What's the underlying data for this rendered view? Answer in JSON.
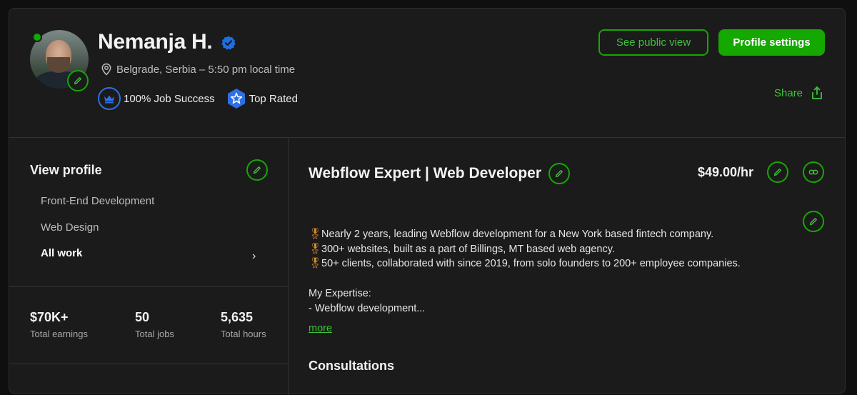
{
  "profile": {
    "name": "Nemanja H.",
    "location": "Belgrade, Serbia – 5:50 pm local time",
    "badges": [
      {
        "label": "100% Job Success"
      },
      {
        "label": "Top Rated"
      }
    ]
  },
  "actions": {
    "public_view": "See public view",
    "settings": "Profile settings",
    "share": "Share"
  },
  "sidebar": {
    "title": "View profile",
    "items": [
      {
        "label": "Front-End Development"
      },
      {
        "label": "Web Design"
      },
      {
        "label": "All work"
      }
    ],
    "chevron": "›"
  },
  "stats": [
    {
      "value": "$70K+",
      "label": "Total earnings"
    },
    {
      "value": "50",
      "label": "Total jobs"
    },
    {
      "value": "5,635",
      "label": "Total hours"
    }
  ],
  "main": {
    "title": "Webflow Expert | Web Developer",
    "rate": "$49.00/hr",
    "bullets": [
      "Nearly 2 years, leading Webflow development for a New York based fintech company.",
      "300+ websites, built as a part of Billings, MT based web agency.",
      "50+ clients, collaborated with since 2019, from solo founders to 200+ employee companies."
    ],
    "expertise_heading": "My Expertise:",
    "expertise_line": "- Webflow development...",
    "more": "more",
    "consultations": "Consultations"
  },
  "colors": {
    "accent": "#14a800",
    "badge_blue": "#2f6fe4",
    "background": "#1b1b1b"
  },
  "icons": {
    "edit": "pencil-icon",
    "verified": "verified-check-icon",
    "location": "location-pin-icon",
    "share": "share-icon",
    "link": "link-icon",
    "job_success": "crown-icon",
    "top_rated": "star-badge-icon",
    "medal": "medal-icon"
  }
}
